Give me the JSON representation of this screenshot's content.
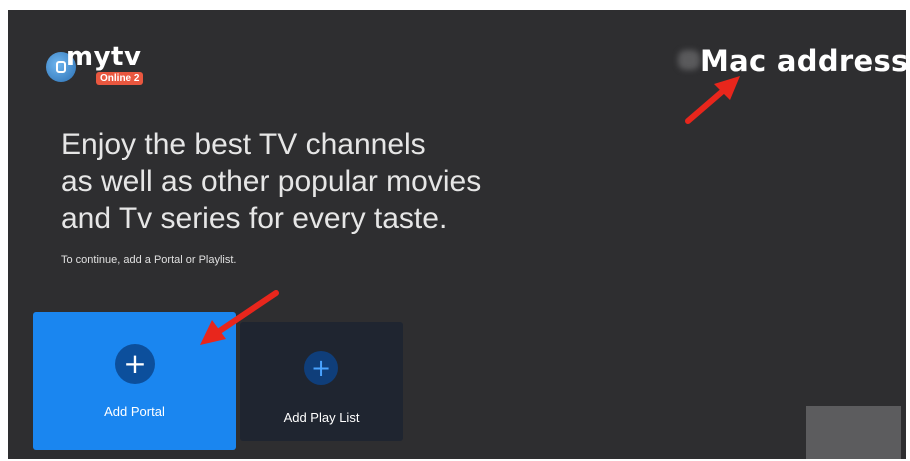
{
  "logo": {
    "text": "mytv",
    "badge": "Online 2"
  },
  "header": {
    "mac_label": "Mac address"
  },
  "headline": {
    "lines": [
      "Enjoy the best TV channels",
      "as well as other popular movies",
      "and Tv series for every taste."
    ]
  },
  "subtext": "To continue, add a Portal or Playlist.",
  "cards": [
    {
      "label": "Add Portal",
      "icon": "plus-icon"
    },
    {
      "label": "Add Play List",
      "icon": "plus-icon"
    }
  ],
  "colors": {
    "background": "#2e2e30",
    "portal_card": "#1a86f0",
    "playlist_card": "#1f2530",
    "annotation_arrow": "#e8261c"
  }
}
